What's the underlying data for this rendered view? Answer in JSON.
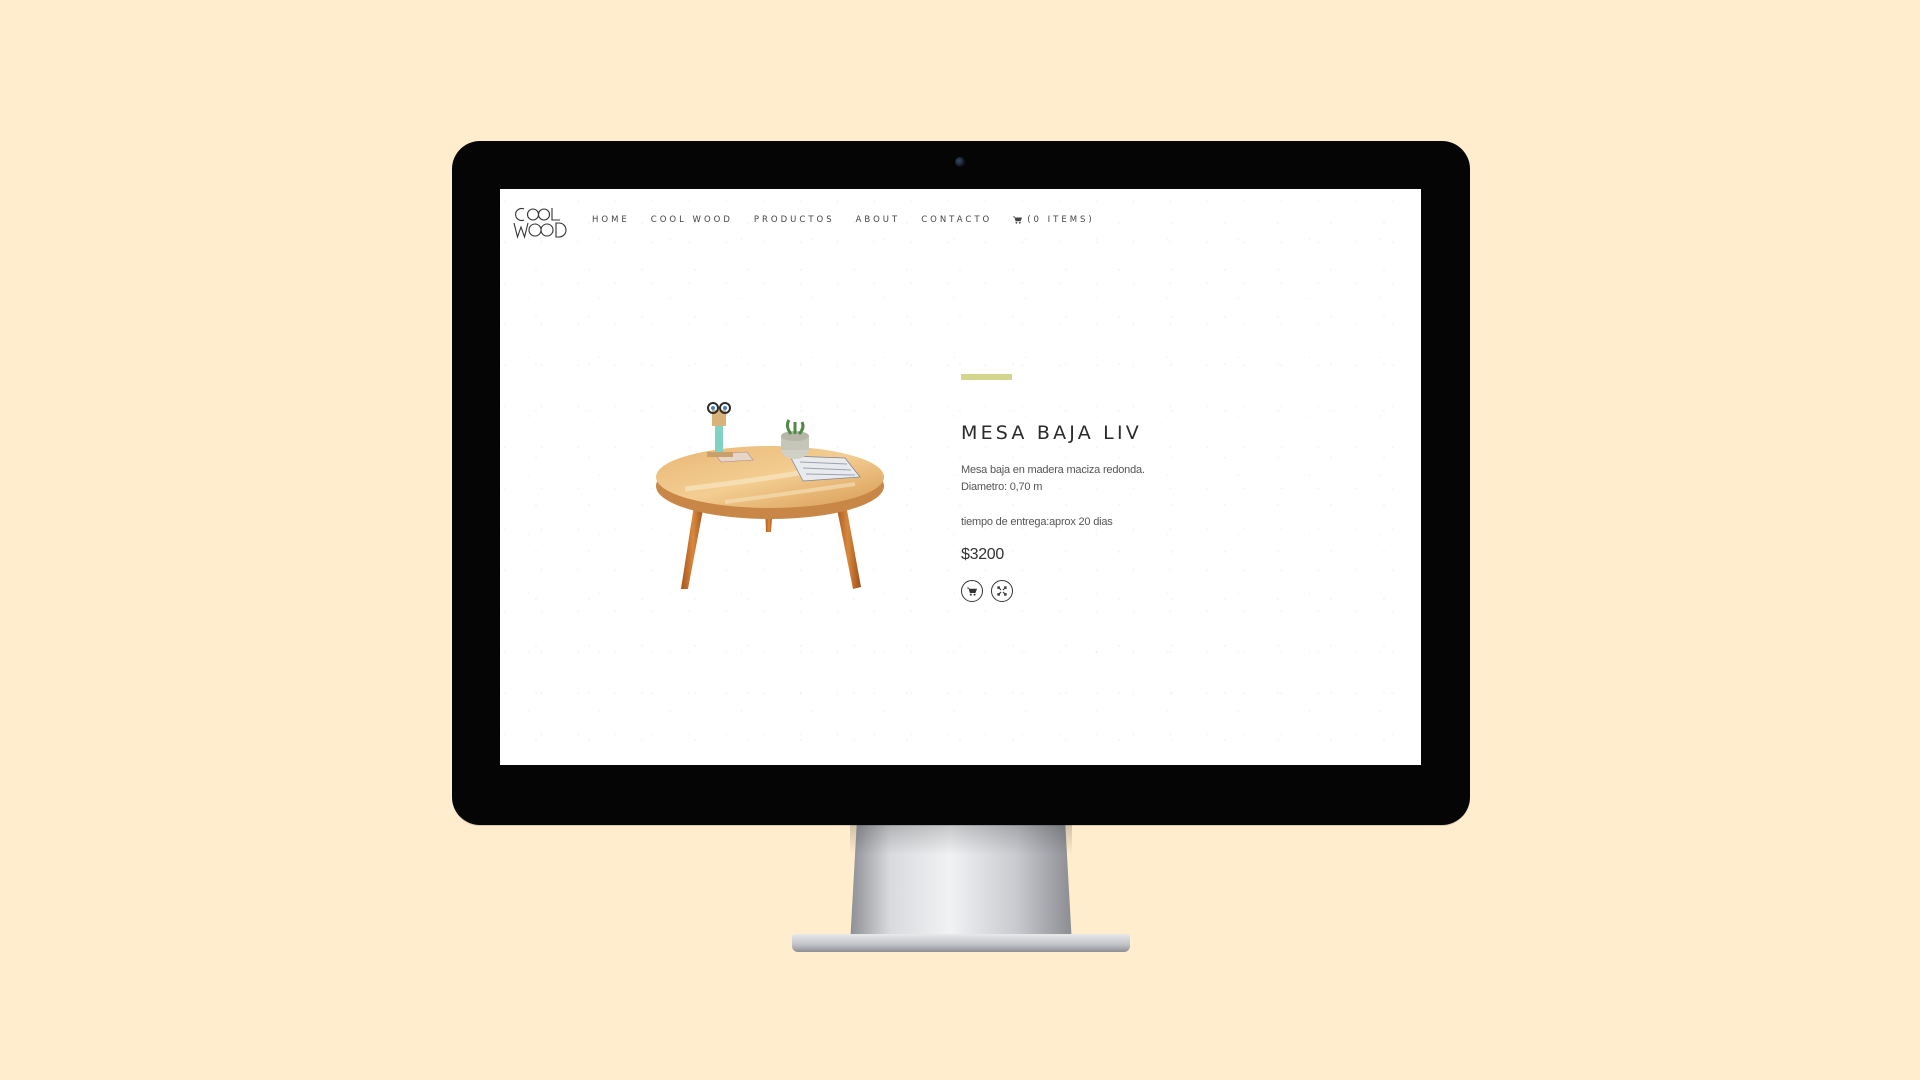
{
  "background_color": "#ffedcd",
  "site": {
    "logo_icon": "coolwood-logo",
    "logo_text": [
      "COOL",
      "WOOD"
    ]
  },
  "nav": {
    "items": [
      {
        "label": "HOME"
      },
      {
        "label": "COOL WOOD"
      },
      {
        "label": "PRODUCTOS"
      },
      {
        "label": "ABOUT"
      },
      {
        "label": "CONTACTO"
      }
    ],
    "cart_icon": "shopping-cart-icon",
    "cart_label": "(0 ITEMS)"
  },
  "product": {
    "accent_color": "#d3d48d",
    "title": "MESA BAJA LIV",
    "description": [
      "Mesa baja en madera maciza redonda.",
      "Diametro: 0,70 m"
    ],
    "delivery": "tiempo de entrega:aprox 20 dias",
    "price": "$3200",
    "image_icon": "round-wooden-coffee-table",
    "actions": [
      {
        "icon": "shopping-cart-icon"
      },
      {
        "icon": "expand-icon"
      }
    ]
  }
}
